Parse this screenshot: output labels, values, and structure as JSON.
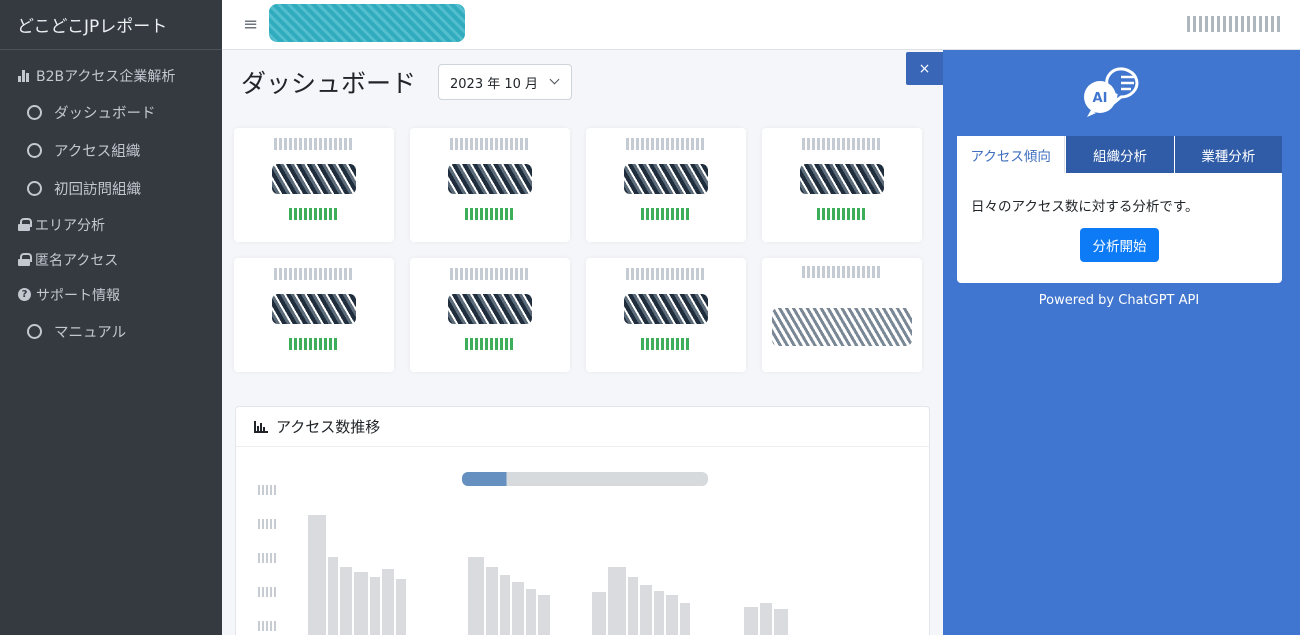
{
  "sidebar": {
    "brand": "どこどこJPレポート",
    "sections": [
      {
        "label": "B2Bアクセス企業解析"
      },
      {
        "label": "エリア分析"
      },
      {
        "label": "匿名アクセス"
      },
      {
        "label": "サポート情報"
      }
    ],
    "items": [
      {
        "label": "ダッシュボード"
      },
      {
        "label": "アクセス組織"
      },
      {
        "label": "初回訪問組織"
      },
      {
        "label": "マニュアル"
      }
    ]
  },
  "header": {
    "menu_icon": "≡"
  },
  "main": {
    "page_title": "ダッシュボード",
    "month_select": "2023 年 10 月",
    "chart_title": "アクセス数推移"
  },
  "ai_panel": {
    "close_label": "×",
    "icon_label": "AI",
    "tabs": [
      {
        "label": "アクセス傾向",
        "active": true
      },
      {
        "label": "組織分析",
        "active": false
      },
      {
        "label": "業種分析",
        "active": false
      }
    ],
    "description": "日々のアクセス数に対する分析です。",
    "analyze_button": "分析開始",
    "powered_by": "Powered by ChatGPT API"
  },
  "colors": {
    "sidebar_bg": "#343a40",
    "panel_bg": "#4076cf",
    "primary_button": "#0d7bf5",
    "active_tab_text": "#3f6fbf"
  }
}
